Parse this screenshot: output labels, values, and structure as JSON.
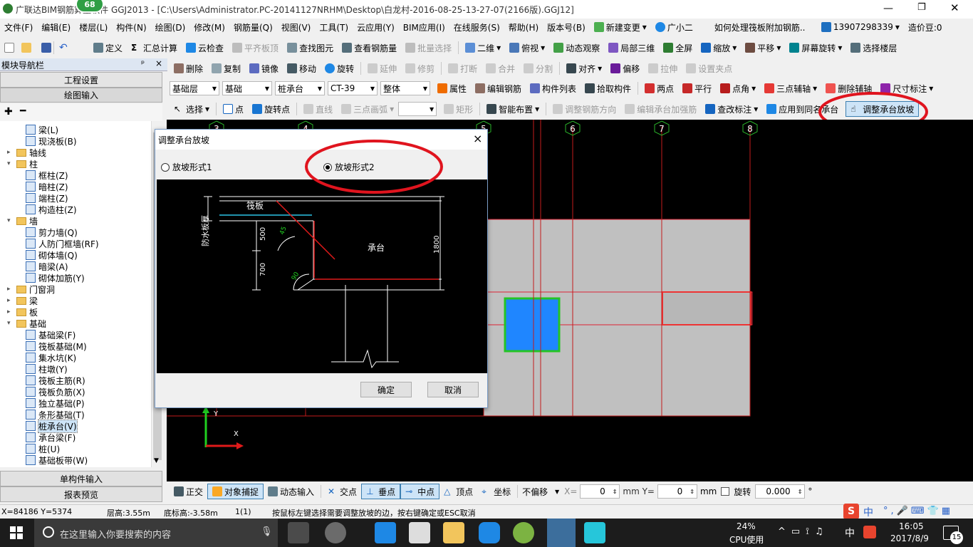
{
  "title_bar": {
    "badge": "68",
    "title": "广联达BIM钢筋算量软件 GGJ2013 - [C:\\Users\\Administrator.PC-20141127NRHM\\Desktop\\白龙村-2016-08-25-13-27-07(2166版).GGJ12]"
  },
  "menu": {
    "items": [
      "文件(F)",
      "编辑(E)",
      "楼层(L)",
      "构件(N)",
      "绘图(D)",
      "修改(M)",
      "钢筋量(Q)",
      "视图(V)",
      "工具(T)",
      "云应用(Y)",
      "BIM应用(I)",
      "在线服务(S)",
      "帮助(H)",
      "版本号(B)"
    ],
    "new_change": "新建变更",
    "assistant": "广小二",
    "question": "如何处理筏板附加钢筋..",
    "phone": "13907298339",
    "beans": "造价豆:0"
  },
  "toolbar1": {
    "items": [
      "定义",
      "汇总计算",
      "云检查",
      "平齐板顶",
      "查找图元",
      "查看钢筋量",
      "批量选择",
      "二维",
      "俯视",
      "动态观察",
      "局部三维",
      "全屏",
      "缩放",
      "平移",
      "屏幕旋转",
      "选择楼层"
    ]
  },
  "toolbar2": {
    "items": [
      "删除",
      "复制",
      "镜像",
      "移动",
      "旋转",
      "延伸",
      "修剪",
      "打断",
      "合并",
      "分割",
      "对齐",
      "偏移",
      "拉伸",
      "设置夹点"
    ]
  },
  "toolbar3": {
    "floor": "基础层",
    "category": "基础",
    "type": "桩承台",
    "name": "CT-39",
    "mode": "整体",
    "items": [
      "属性",
      "编辑钢筋",
      "构件列表",
      "拾取构件",
      "两点",
      "平行",
      "点角",
      "三点辅轴",
      "删除辅轴",
      "尺寸标注"
    ]
  },
  "toolbar4": {
    "items": [
      "选择",
      "点",
      "旋转点",
      "直线",
      "三点画弧",
      "矩形",
      "智能布置",
      "调整钢筋方向",
      "编辑承台加强筋",
      "查改标注",
      "应用到同名承台",
      "调整承台放坡"
    ]
  },
  "nav": {
    "title": "模块导航栏",
    "pin": "ᵖ",
    "close": "×",
    "btn_engineering": "工程设置",
    "btn_drawing": "绘图输入",
    "btn_single": "单构件输入",
    "btn_report": "报表预览"
  },
  "tree": [
    {
      "label": "梁(L)",
      "level": 2,
      "kind": "leaf"
    },
    {
      "label": "现浇板(B)",
      "level": 2,
      "kind": "leaf"
    },
    {
      "label": "轴线",
      "level": 0,
      "kind": "folder",
      "exp": "▸"
    },
    {
      "label": "柱",
      "level": 0,
      "kind": "folder",
      "exp": "▾"
    },
    {
      "label": "框柱(Z)",
      "level": 2,
      "kind": "leaf"
    },
    {
      "label": "暗柱(Z)",
      "level": 2,
      "kind": "leaf"
    },
    {
      "label": "端柱(Z)",
      "level": 2,
      "kind": "leaf"
    },
    {
      "label": "构造柱(Z)",
      "level": 2,
      "kind": "leaf"
    },
    {
      "label": "墙",
      "level": 0,
      "kind": "folder",
      "exp": "▾"
    },
    {
      "label": "剪力墙(Q)",
      "level": 2,
      "kind": "leaf"
    },
    {
      "label": "人防门框墙(RF)",
      "level": 2,
      "kind": "leaf"
    },
    {
      "label": "砌体墙(Q)",
      "level": 2,
      "kind": "leaf"
    },
    {
      "label": "暗梁(A)",
      "level": 2,
      "kind": "leaf"
    },
    {
      "label": "砌体加筋(Y)",
      "level": 2,
      "kind": "leaf"
    },
    {
      "label": "门窗洞",
      "level": 0,
      "kind": "folder",
      "exp": "▸"
    },
    {
      "label": "梁",
      "level": 0,
      "kind": "folder",
      "exp": "▸"
    },
    {
      "label": "板",
      "level": 0,
      "kind": "folder",
      "exp": "▸"
    },
    {
      "label": "基础",
      "level": 0,
      "kind": "folder",
      "exp": "▾"
    },
    {
      "label": "基础梁(F)",
      "level": 2,
      "kind": "leaf"
    },
    {
      "label": "筏板基础(M)",
      "level": 2,
      "kind": "leaf"
    },
    {
      "label": "集水坑(K)",
      "level": 2,
      "kind": "leaf"
    },
    {
      "label": "柱墩(Y)",
      "level": 2,
      "kind": "leaf"
    },
    {
      "label": "筏板主筋(R)",
      "level": 2,
      "kind": "leaf"
    },
    {
      "label": "筏板负筋(X)",
      "level": 2,
      "kind": "leaf"
    },
    {
      "label": "独立基础(P)",
      "level": 2,
      "kind": "leaf"
    },
    {
      "label": "条形基础(T)",
      "level": 2,
      "kind": "leaf"
    },
    {
      "label": "桩承台(V)",
      "level": 2,
      "kind": "leaf",
      "selected": true
    },
    {
      "label": "承台梁(F)",
      "level": 2,
      "kind": "leaf"
    },
    {
      "label": "桩(U)",
      "level": 2,
      "kind": "leaf"
    },
    {
      "label": "基础板带(W)",
      "level": 2,
      "kind": "leaf"
    }
  ],
  "axes": [
    "3",
    "4",
    "5",
    "6",
    "7",
    "8"
  ],
  "dialog": {
    "title": "调整承台放坡",
    "close": "×",
    "option1": "放坡形式1",
    "option2": "放坡形式2",
    "selected": "option2",
    "ok": "确定",
    "cancel": "取消",
    "figure": {
      "raft": "筏板",
      "waterproof": "防水板厚",
      "cap": "承台",
      "dim500": "500",
      "dim700": "700",
      "dim1800": "1800",
      "ang45": "45",
      "ang90": "90"
    }
  },
  "snapbar": {
    "items": [
      "正交",
      "对象捕捉",
      "动态输入",
      "交点",
      "垂点",
      "中点",
      "顶点",
      "坐标"
    ],
    "offset_mode": "不偏移",
    "x_label": "X=",
    "x_value": "0",
    "y_label": "mm Y=",
    "y_value": "0",
    "mm": "mm",
    "rotate_label": "旋转",
    "rotate_value": "0.000",
    "deg": "°"
  },
  "statusbar": {
    "coords": "X=84186 Y=5374",
    "floor_height": "层高:3.55m",
    "base_height": "底标高:-3.58m",
    "count": "1(1)",
    "hint": "按鼠标左键选择需要调整放坡的边，按右键确定或ESC取消"
  },
  "ime": {
    "s_logo": "S",
    "lang": "中"
  },
  "taskbar": {
    "search_placeholder": "在这里输入你要搜索的内容",
    "cpu_pct": "24%",
    "cpu_label": "CPU使用",
    "ime": "中",
    "time": "16:05",
    "date": "2017/8/9",
    "notif": "15"
  }
}
